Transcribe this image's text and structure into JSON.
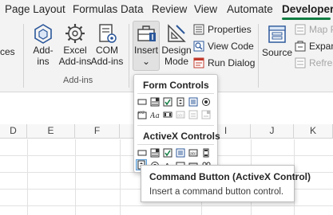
{
  "tabs": [
    {
      "label": "Page Layout"
    },
    {
      "label": "Formulas"
    },
    {
      "label": "Data"
    },
    {
      "label": "Review"
    },
    {
      "label": "View"
    },
    {
      "label": "Automate"
    },
    {
      "label": "Developer",
      "active": true
    }
  ],
  "ribbon": {
    "cut_left_label": "ces",
    "addins_group_label": "Add-ins",
    "addins": {
      "line1": "Add-",
      "line2": "ins"
    },
    "excel_addins": {
      "line1": "Excel",
      "line2": "Add-ins"
    },
    "com_addins": {
      "line1": "COM",
      "line2": "Add-ins"
    },
    "insert": {
      "label": "Insert",
      "chevron": "⌄"
    },
    "design_mode": {
      "line1": "Design",
      "line2": "Mode"
    },
    "properties": "Properties",
    "view_code": "View Code",
    "run_dialog": "Run Dialog",
    "source": "Source",
    "map_properties": "Map P",
    "expansion_packs": "Expans",
    "refresh_data": "Refresh"
  },
  "columns": [
    "D",
    "E",
    "F",
    "I",
    "J",
    "K"
  ],
  "dropdown": {
    "form_controls_title": "Form Controls",
    "activex_controls_title": "ActiveX Controls",
    "form_controls": [
      "button",
      "combo-box",
      "check-box",
      "spin-button",
      "list-box",
      "option-button",
      "group-box",
      "label",
      "scroll-bar",
      "text-field",
      "combo-list-edit",
      "combo-drop-down-edit"
    ],
    "activex_controls": [
      "command-button",
      "combo-box",
      "check-box",
      "list-box",
      "text-box",
      "scroll-bar",
      "spin-button",
      "option-button",
      "label",
      "image",
      "toggle-button",
      "more-controls"
    ]
  },
  "tooltip": {
    "title": "Command Button (ActiveX Control)",
    "body": "Insert a command button control."
  },
  "colors": {
    "developer_underline": "#107c41",
    "hover_fill": "#cde4f7",
    "hover_border": "#5b9bd5"
  }
}
